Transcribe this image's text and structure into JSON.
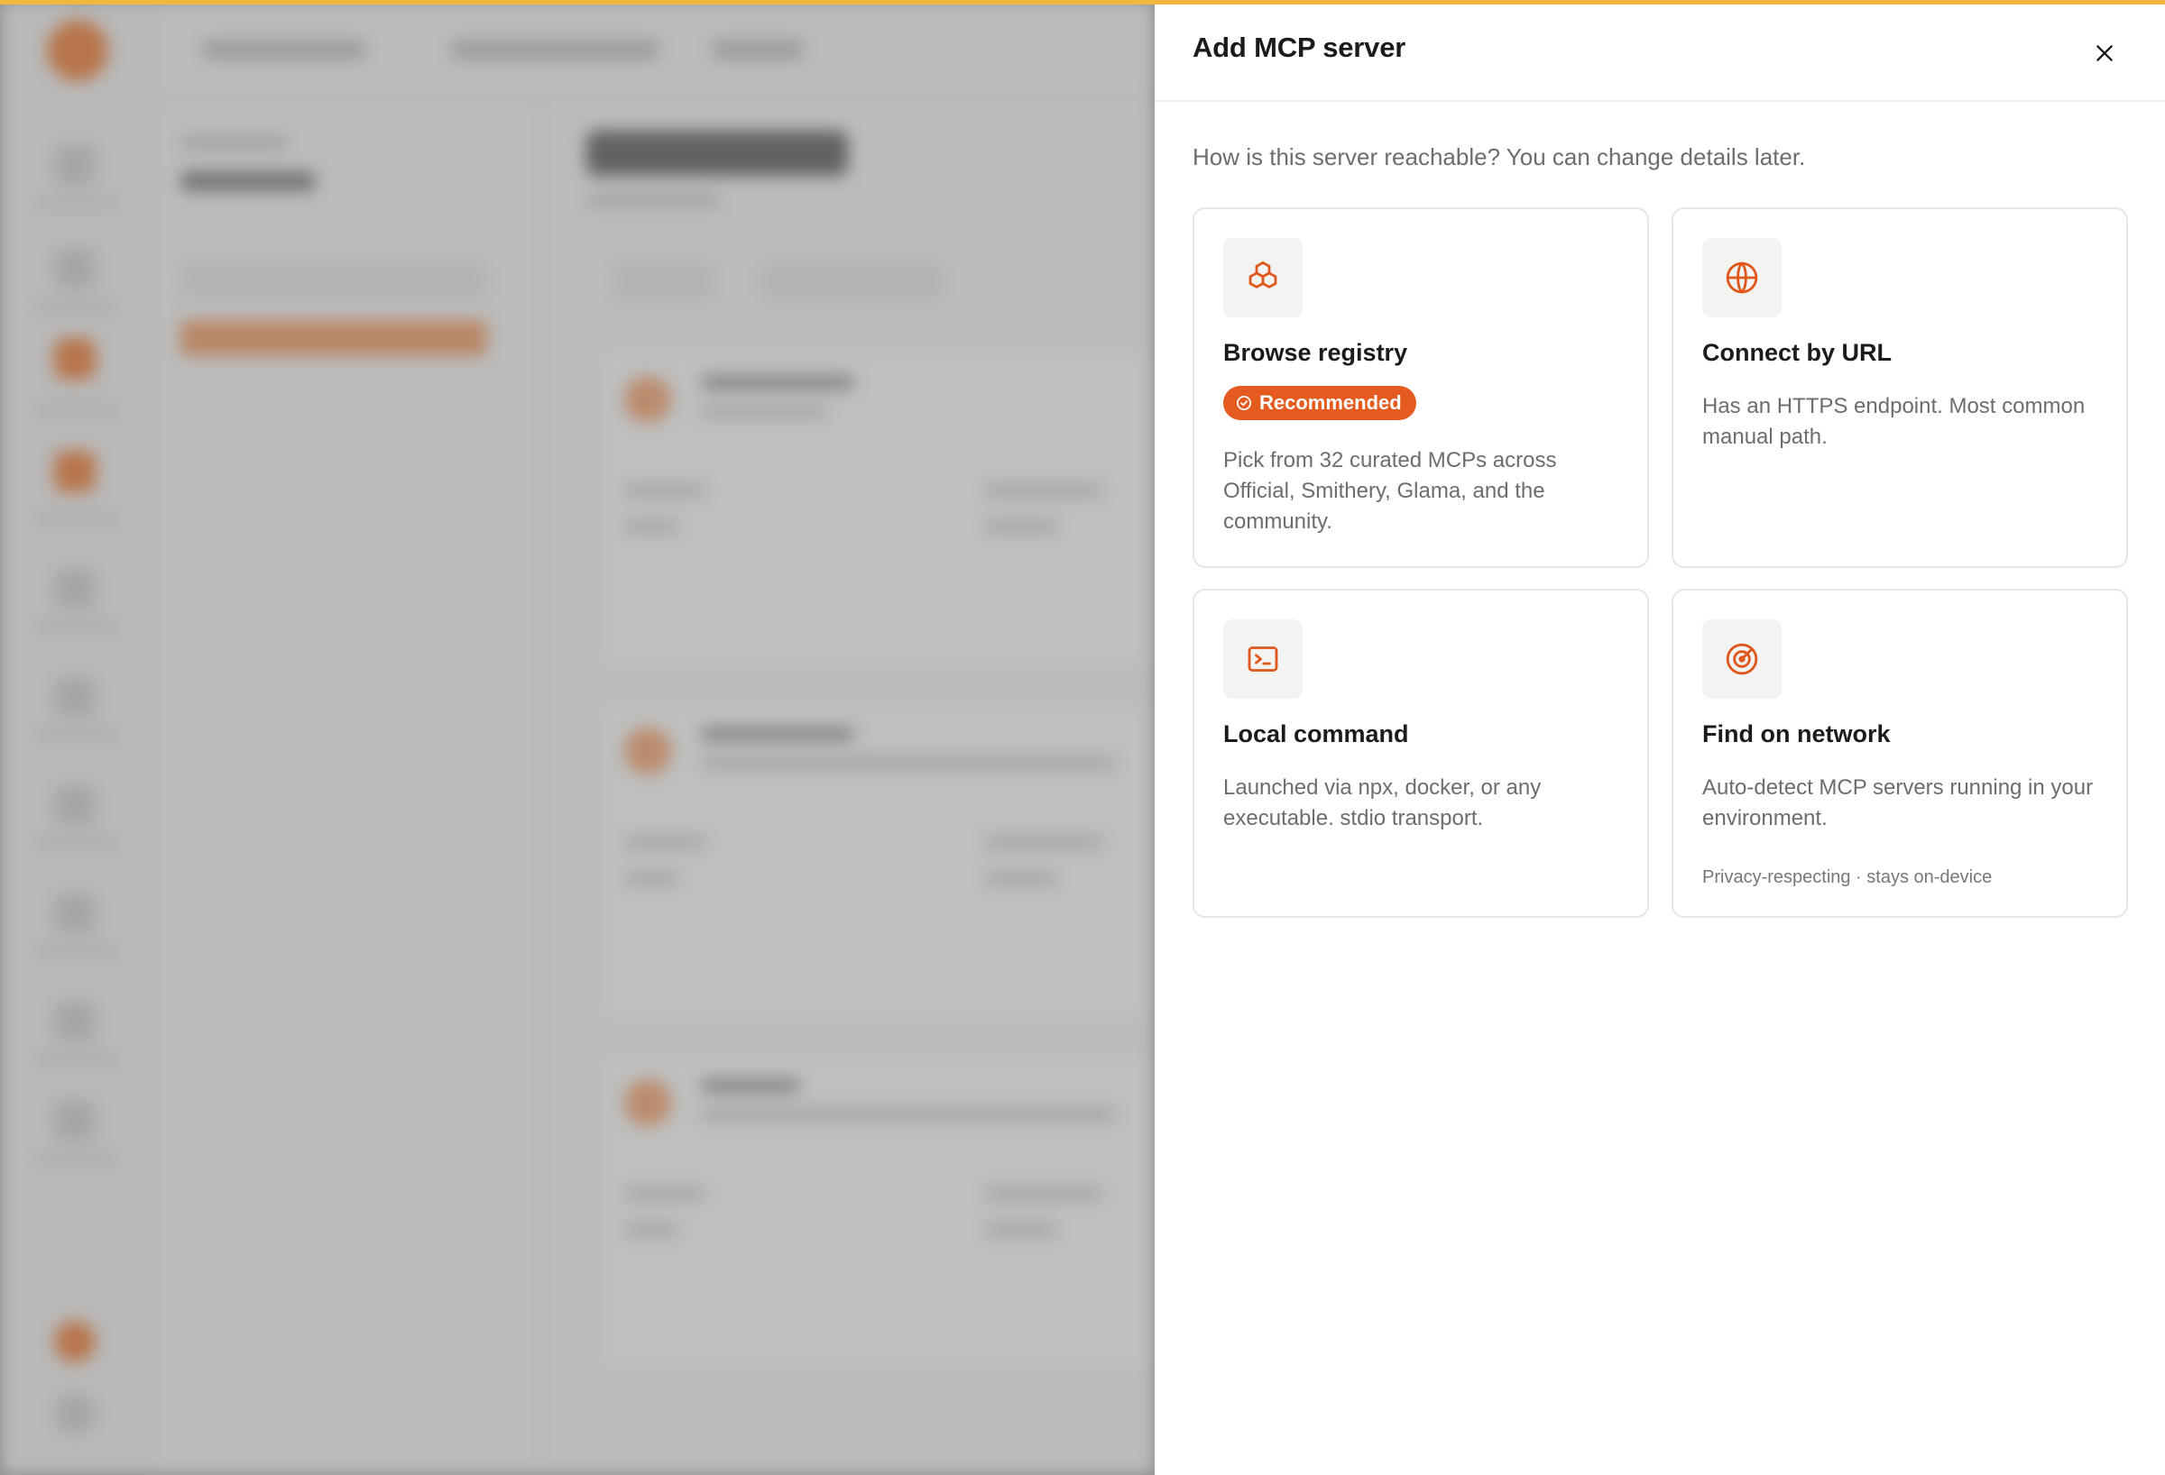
{
  "drawer": {
    "title": "Add MCP server",
    "close_icon": "close-icon",
    "subtitle": "How is this server reachable? You can change details later."
  },
  "options": [
    {
      "icon": "cubes-icon",
      "title": "Browse registry",
      "badge": "Recommended",
      "description": "Pick from 32 curated MCPs across Official, Smithery, Glama, and the community."
    },
    {
      "icon": "globe-icon",
      "title": "Connect by URL",
      "description": "Has an HTTPS endpoint. Most common manual path."
    },
    {
      "icon": "terminal-icon",
      "title": "Local command",
      "description": "Launched via npx, docker, or any executable. stdio transport."
    },
    {
      "icon": "radar-icon",
      "title": "Find on network",
      "description": "Auto-detect MCP servers running in your environment.",
      "note": "Privacy-respecting · stays on-device"
    }
  ],
  "colors": {
    "accent": "#e55b1f",
    "top_bar": "#f2b73f",
    "icon_stroke": "#e0571c"
  }
}
